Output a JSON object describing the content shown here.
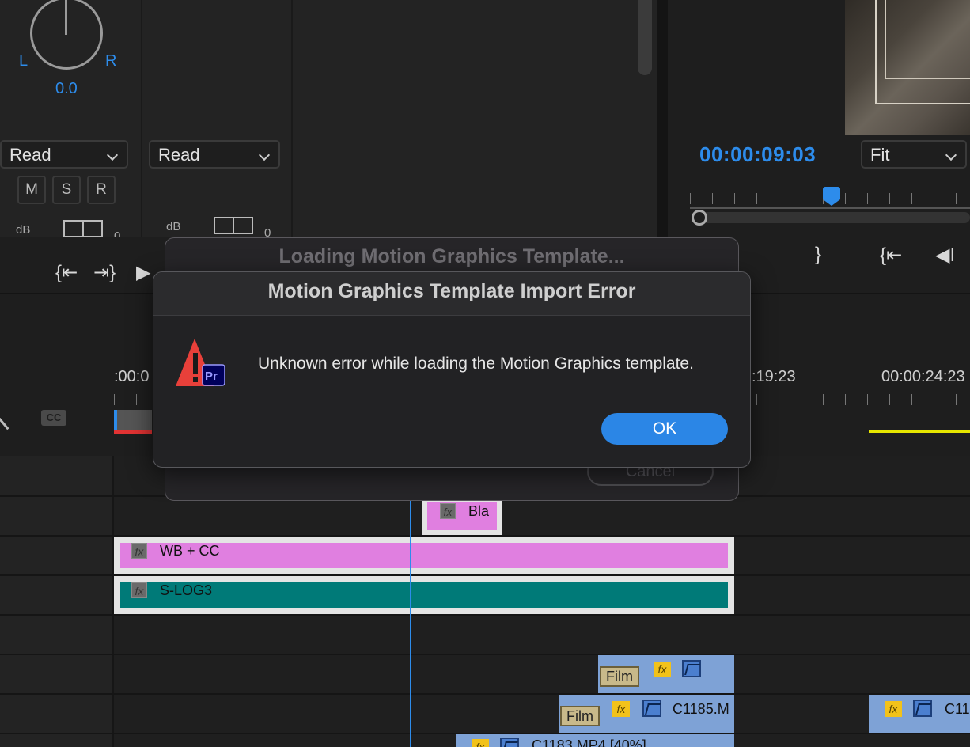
{
  "audio_mixer": {
    "pan_left_label": "L",
    "pan_right_label": "R",
    "pan_value": "0.0",
    "track1_automation": "Read",
    "track2_automation": "Read",
    "mute_label": "M",
    "solo_label": "S",
    "record_label": "R",
    "db_label": "dB",
    "meter_zero": "0"
  },
  "transport": {
    "go_to_in": "{⇤",
    "go_to_out": "⇥}",
    "play": "▶"
  },
  "program_monitor": {
    "timecode": "00:00:09:03",
    "zoom": "Fit",
    "mark_out": "}",
    "go_to_in": "{⇤",
    "step_back": "◀I"
  },
  "timeline": {
    "ruler_start": ":00:0",
    "ruler_mid": ":19:23",
    "ruler_end": "00:00:24:23",
    "cc_label": "CC",
    "clips": {
      "bla_label": "Bla",
      "wbcc_label": "WB + CC",
      "slog_label": "S-LOG3",
      "film_tag": "Film",
      "c1185_label": "C1185.M",
      "c11_label": "C11",
      "c1183_label": "C1183.MP4 [40%]"
    },
    "fx_badge": "fx",
    "colors": {
      "wbcc": "#e07fe0",
      "slog": "#007a78",
      "video_clip": "#7ea2d6",
      "playhead": "#2d8ceb"
    }
  },
  "background_dialog": {
    "title": "Loading Motion Graphics Template...",
    "cancel_label": "Cancel"
  },
  "error_dialog": {
    "title": "Motion Graphics Template Import Error",
    "message": "Unknown error while loading the Motion Graphics template.",
    "ok_label": "OK",
    "app_badge": "Pr",
    "icon": "warning-icon"
  }
}
